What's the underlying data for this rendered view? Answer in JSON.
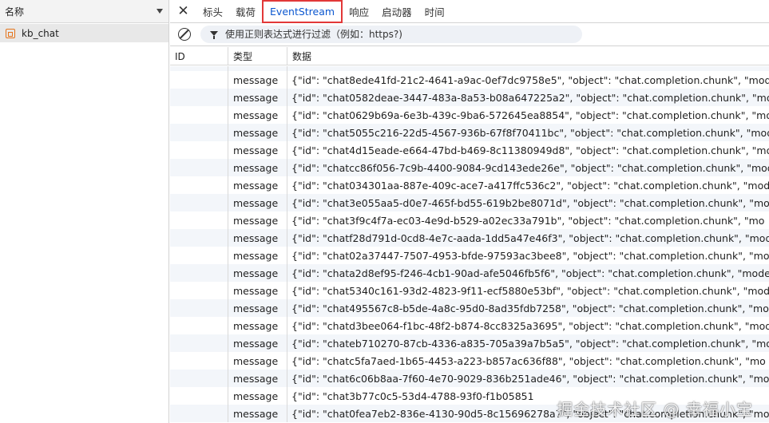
{
  "left_panel": {
    "header_title": "名称",
    "requests": [
      {
        "name": "kb_chat"
      }
    ]
  },
  "tabs": [
    {
      "label": "标头",
      "active": false
    },
    {
      "label": "载荷",
      "active": false
    },
    {
      "label": "EventStream",
      "active": true
    },
    {
      "label": "响应",
      "active": false
    },
    {
      "label": "启动器",
      "active": false
    },
    {
      "label": "时间",
      "active": false
    }
  ],
  "filter": {
    "placeholder": "使用正则表达式进行过滤（例如：https?)"
  },
  "table": {
    "headers": {
      "id": "ID",
      "type": "类型",
      "data": "数据"
    },
    "rows": [
      {
        "id": "",
        "type": "message",
        "data": "{\"id\": \"chat8ede41fd-21c2-4641-a9ac-0ef7dc9758e5\", \"object\": \"chat.completion.chunk\", \"mod"
      },
      {
        "id": "",
        "type": "message",
        "data": "{\"id\": \"chat0582deae-3447-483a-8a53-b08a647225a2\", \"object\": \"chat.completion.chunk\", \"mod"
      },
      {
        "id": "",
        "type": "message",
        "data": "{\"id\": \"chat0629b69a-6e3b-439c-9ba6-572645ea8854\", \"object\": \"chat.completion.chunk\", \"mod"
      },
      {
        "id": "",
        "type": "message",
        "data": "{\"id\": \"chat5055c216-22d5-4567-936b-67f8f70411bc\", \"object\": \"chat.completion.chunk\", \"mod"
      },
      {
        "id": "",
        "type": "message",
        "data": "{\"id\": \"chat4d15eade-e664-47bd-b469-8c11380949d8\", \"object\": \"chat.completion.chunk\", \"mo"
      },
      {
        "id": "",
        "type": "message",
        "data": "{\"id\": \"chatcc86f056-7c9b-4400-9084-9cd143ede26e\", \"object\": \"chat.completion.chunk\", \"mod"
      },
      {
        "id": "",
        "type": "message",
        "data": "{\"id\": \"chat034301aa-887e-409c-ace7-a417ffc536c2\", \"object\": \"chat.completion.chunk\", \"mode"
      },
      {
        "id": "",
        "type": "message",
        "data": "{\"id\": \"chat3e055aa5-d0e7-465f-bd55-619b2be8071d\", \"object\": \"chat.completion.chunk\", \"mod"
      },
      {
        "id": "",
        "type": "message",
        "data": "{\"id\": \"chat3f9c4f7a-ec03-4e9d-b529-a02ec33a791b\", \"object\": \"chat.completion.chunk\", \"mo"
      },
      {
        "id": "",
        "type": "message",
        "data": "{\"id\": \"chatf28d791d-0cd8-4e7c-aada-1dd5a47e46f3\", \"object\": \"chat.completion.chunk\", \"mod"
      },
      {
        "id": "",
        "type": "message",
        "data": "{\"id\": \"chat02a37447-7507-4953-bfde-97593ac3bee8\", \"object\": \"chat.completion.chunk\", \"mo"
      },
      {
        "id": "",
        "type": "message",
        "data": "{\"id\": \"chata2d8ef95-f246-4cb1-90ad-afe5046fb5f6\", \"object\": \"chat.completion.chunk\", \"mode"
      },
      {
        "id": "",
        "type": "message",
        "data": "{\"id\": \"chat5340c161-93d2-4823-9f11-ecf5880e53bf\", \"object\": \"chat.completion.chunk\", \"mode"
      },
      {
        "id": "",
        "type": "message",
        "data": "{\"id\": \"chat495567c8-b5de-4a8c-95d0-8ad35fdb7258\", \"object\": \"chat.completion.chunk\", \"mod"
      },
      {
        "id": "",
        "type": "message",
        "data": "{\"id\": \"chatd3bee064-f1bc-48f2-b874-8cc8325a3695\", \"object\": \"chat.completion.chunk\", \"mod"
      },
      {
        "id": "",
        "type": "message",
        "data": "{\"id\": \"chateb710270-87cb-4336-a835-705a39a7b5a5\", \"object\": \"chat.completion.chunk\", \"mo"
      },
      {
        "id": "",
        "type": "message",
        "data": "{\"id\": \"chatc5fa7aed-1b65-4453-a223-b857ac636f88\", \"object\": \"chat.completion.chunk\", \"mo"
      },
      {
        "id": "",
        "type": "message",
        "data": "{\"id\": \"chat6c06b8aa-7f60-4e70-9029-836b251ade46\", \"object\": \"chat.completion.chunk\", \"mod"
      },
      {
        "id": "",
        "type": "message",
        "data": "{\"id\": \"chat3b77c0c5-53d4-4788-93f0-f1b05851"
      },
      {
        "id": "",
        "type": "message",
        "data": "{\"id\": \"chat0fea7eb2-836e-4130-90d5-8c15696278a7\", \"object\": \"chat.completion.chunk\", \"mo"
      }
    ]
  },
  "watermark": "掘金技术社区 @ 幸福小宝",
  "colors": {
    "active_tab_text": "#0b57d0",
    "active_tab_border": "#e23838",
    "request_icon": "#e5741b"
  }
}
